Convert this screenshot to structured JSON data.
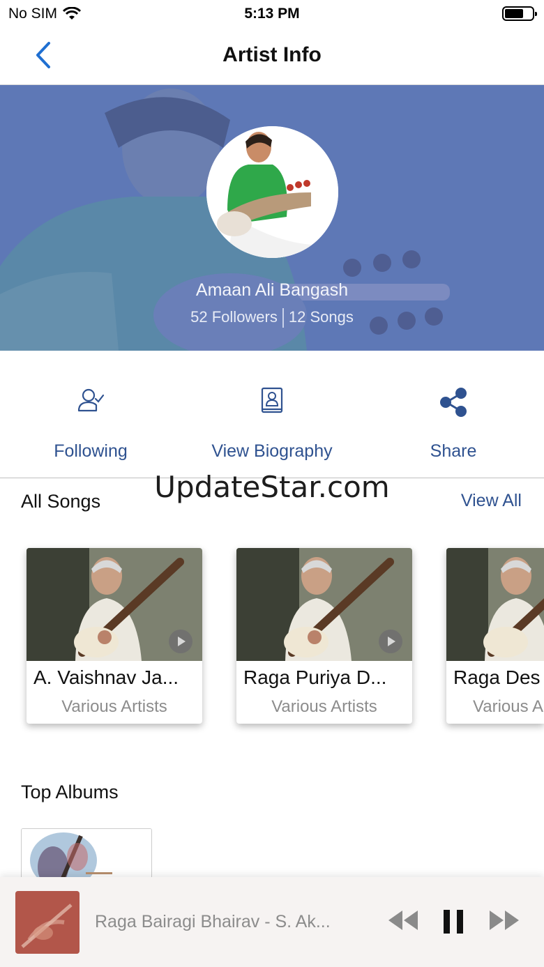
{
  "status_bar": {
    "carrier": "No SIM",
    "time": "5:13 PM"
  },
  "nav": {
    "title": "Artist Info",
    "back_icon": "chevron-left-icon"
  },
  "artist": {
    "name": "Amaan Ali Bangash",
    "followers": "52 Followers",
    "songs": "12 Songs"
  },
  "actions": [
    {
      "label": "Following",
      "icon": "user-check-icon"
    },
    {
      "label": "View Biography",
      "icon": "biography-book-icon"
    },
    {
      "label": "Share",
      "icon": "share-icon"
    }
  ],
  "watermark": "UpdateStar.com",
  "all_songs": {
    "title": "All Songs",
    "view_all": "View All",
    "items": [
      {
        "title": "A. Vaishnav Ja...",
        "subtitle": "Various Artists"
      },
      {
        "title": "Raga Puriya D...",
        "subtitle": "Various Artists"
      },
      {
        "title": "Raga Des",
        "subtitle": "Various A"
      }
    ]
  },
  "top_albums": {
    "title": "Top Albums"
  },
  "player": {
    "title": "Raga Bairagi Bhairav - S. Ak...",
    "controls": [
      "rewind-icon",
      "pause-icon",
      "fast-forward-icon"
    ]
  },
  "colors": {
    "accent": "#2f5290",
    "hero_overlay": "#5e78b6",
    "muted_text": "#8c8c8c"
  }
}
